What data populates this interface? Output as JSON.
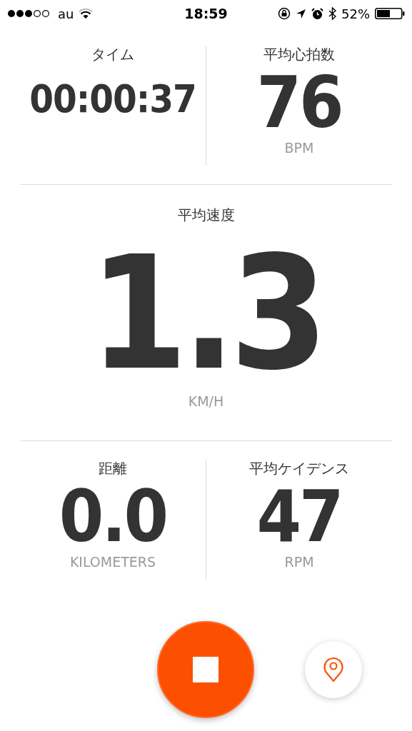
{
  "status_bar": {
    "carrier": "au",
    "time": "18:59",
    "battery": "52%"
  },
  "top": [
    {
      "label": "タイム",
      "value": "00:00:37",
      "kind": "time"
    },
    {
      "label": "平均心拍数",
      "value": "76",
      "unit": "BPM",
      "kind": "number"
    }
  ],
  "middle": {
    "label": "平均速度",
    "value": "1.3",
    "unit": "KM/H"
  },
  "bottom": [
    {
      "label": "距離",
      "value": "0.0",
      "unit": "KILOMETERS",
      "kind": "number"
    },
    {
      "label": "平均ケイデンス",
      "value": "47",
      "unit": "RPM",
      "kind": "number"
    }
  ]
}
